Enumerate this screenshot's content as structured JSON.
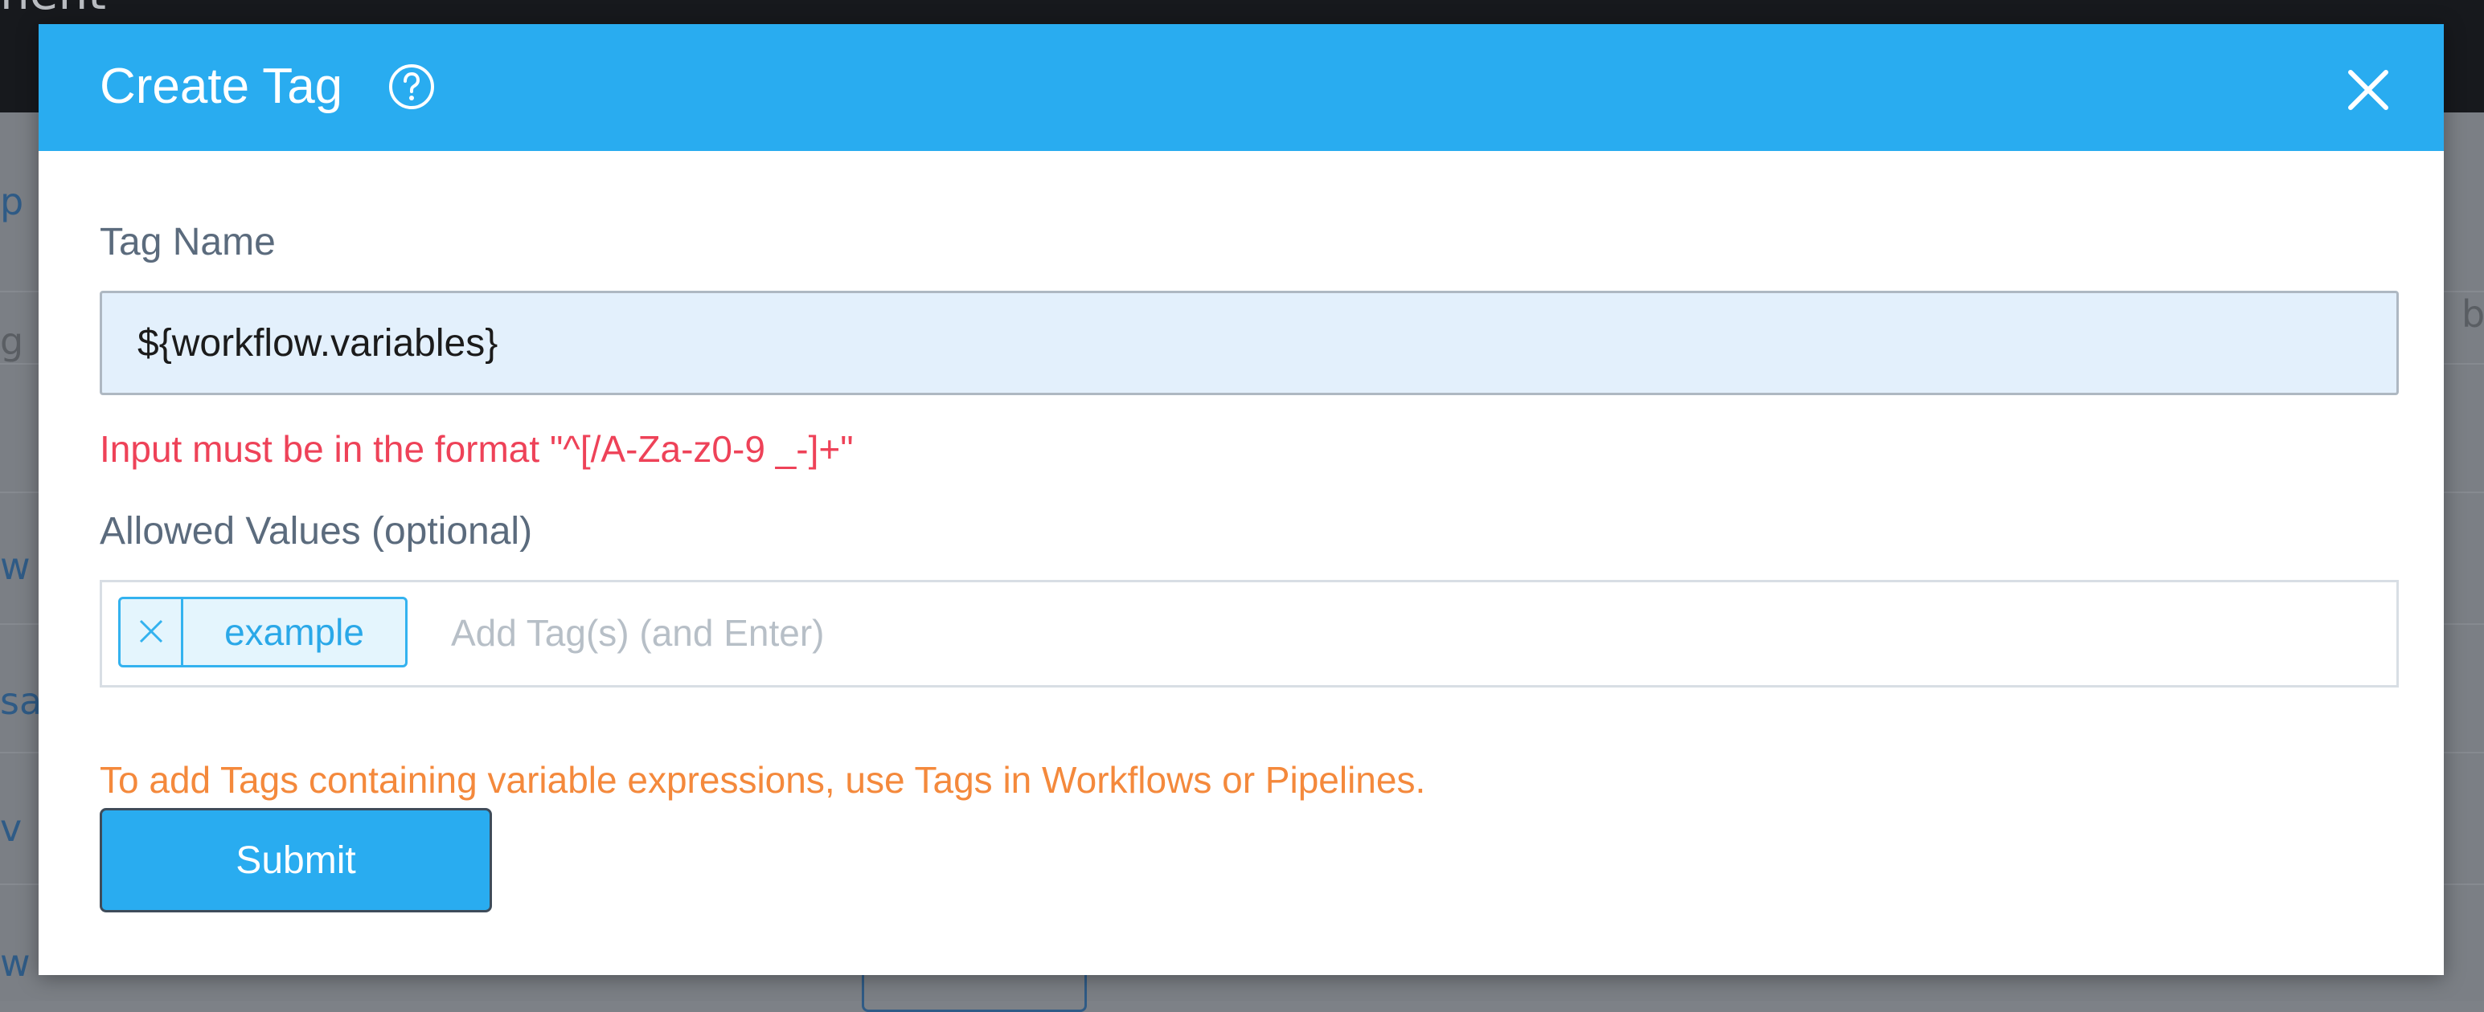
{
  "background": {
    "page_title_fragment": "nent",
    "left_fragments": [
      "p",
      "g",
      "w",
      "sa",
      "v",
      "w"
    ],
    "right_fragment": "b"
  },
  "dialog": {
    "title": "Create Tag",
    "help_icon": "question-circle-icon",
    "close_icon": "close-icon",
    "tag_name": {
      "label": "Tag Name",
      "value": "${workflow.variables}",
      "error": "Input must be in the format \"^[/A-Za-z0-9 _-]+\""
    },
    "allowed_values": {
      "label": "Allowed Values (optional)",
      "tags": [
        {
          "label": "example",
          "remove_icon": "close-icon"
        }
      ],
      "placeholder": "Add Tag(s) (and Enter)"
    },
    "warning": "To add Tags containing variable expressions, use Tags in Workflows or Pipelines.",
    "submit_label": "Submit"
  },
  "colors": {
    "header": "#29acf0",
    "error": "#ee4258",
    "warning": "#f4893c",
    "tag_chip": "#33b2ef",
    "input_bg": "#e3f0fc"
  }
}
